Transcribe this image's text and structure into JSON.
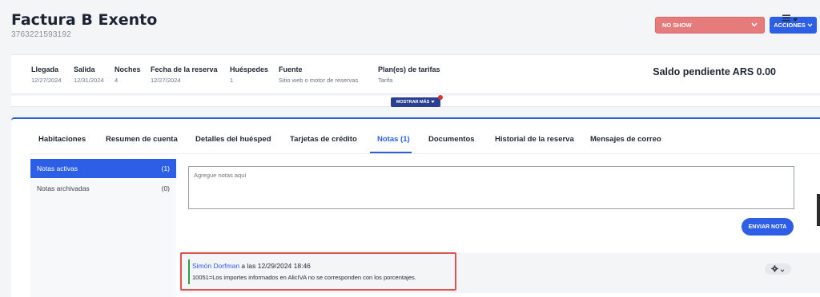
{
  "header": {
    "title": "Factura B Exento",
    "reservation_number": "3763221593192",
    "status_dropdown": "NO SHOW",
    "actions_button": "ACCIONES"
  },
  "summary": {
    "fields": [
      {
        "label": "Llegada",
        "value": "12/27/2024"
      },
      {
        "label": "Salida",
        "value": "12/31/2024"
      },
      {
        "label": "Noches",
        "value": "4"
      },
      {
        "label": "Fecha de la reserva",
        "value": "12/27/2024"
      },
      {
        "label": "Huéspedes",
        "value": "1"
      },
      {
        "label": "Fuente",
        "value": "Sitio web o motor de reservas"
      },
      {
        "label": "Plan(es) de tarifas",
        "value": "Tarifa"
      }
    ],
    "balance": "Saldo pendiente ARS 0.00",
    "show_more": "MOSTRAR MÁS"
  },
  "tabs": [
    {
      "label": "Habitaciones"
    },
    {
      "label": "Resumen de cuenta"
    },
    {
      "label": "Detalles del huésped"
    },
    {
      "label": "Tarjetas de crédito"
    },
    {
      "label": "Notas (1)"
    },
    {
      "label": "Documentos"
    },
    {
      "label": "Historial de la reserva"
    },
    {
      "label": "Mensajes de correo"
    }
  ],
  "active_tab": "Notas (1)",
  "sidebar": {
    "items": [
      {
        "label": "Notas activas",
        "count": "(1)"
      },
      {
        "label": "Notas archivadas",
        "count": "(0)"
      }
    ]
  },
  "notes": {
    "placeholder": "Agregue notas aquí",
    "send_button": "ENVIAR NOTA",
    "entries": [
      {
        "author": "Simón Dorfman",
        "meta": " a las 12/29/2024 18:46",
        "text": "10051=Los importes informados en AlicIVA no se corresponden con los porcentajes."
      }
    ]
  },
  "colors": {
    "accent": "#2c5fe6",
    "status": "#e57b7b",
    "highlight_border": "#e0524f",
    "note_bar": "#2f9e44"
  }
}
